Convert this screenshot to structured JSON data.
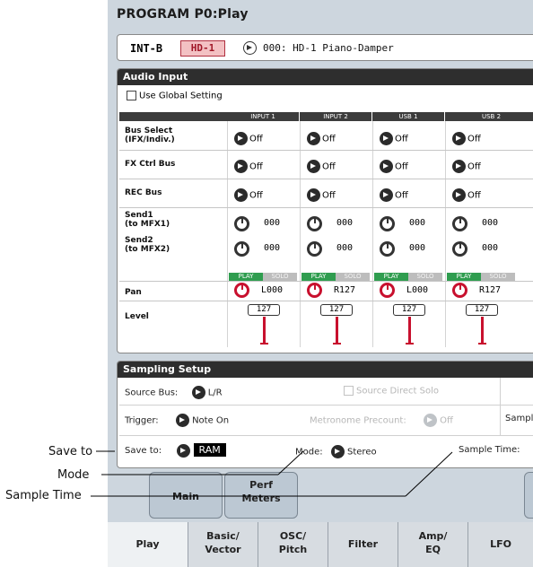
{
  "screen": {
    "title": "PROGRAM P0:Play"
  },
  "program": {
    "bank": "INT-B",
    "badge": "HD-1",
    "name": "000: HD-1 Piano-Damper"
  },
  "audio_input": {
    "section_label": "Audio Input",
    "use_global_setting": "Use Global Setting",
    "use_global_checked": false,
    "columns": [
      "INPUT 1",
      "INPUT 2",
      "USB 1",
      "USB 2"
    ],
    "rows": {
      "bus_select": "Bus Select\n(IFX/Indiv.)",
      "fx_ctrl_bus": "FX Ctrl Bus",
      "rec_bus": "REC Bus",
      "send1": "Send1\n(to MFX1)",
      "send2": "Send2\n(to MFX2)",
      "pan": "Pan",
      "level": "Level"
    },
    "values": {
      "bus_select": [
        "Off",
        "Off",
        "Off",
        "Off"
      ],
      "fx_ctrl_bus": [
        "Off",
        "Off",
        "Off",
        "Off"
      ],
      "rec_bus": [
        "Off",
        "Off",
        "Off",
        "Off"
      ],
      "send1": [
        "000",
        "000",
        "000",
        "000"
      ],
      "send2": [
        "000",
        "000",
        "000",
        "000"
      ],
      "pan": [
        "L000",
        "R127",
        "L000",
        "R127"
      ],
      "level": [
        "127",
        "127",
        "127",
        "127"
      ],
      "play": [
        "PLAY",
        "PLAY",
        "PLAY",
        "PLAY"
      ],
      "solo": [
        "SOLO",
        "SOLO",
        "SOLO",
        "SOLO"
      ]
    }
  },
  "sampling": {
    "section_label": "Sampling Setup",
    "source_bus_label": "Source Bus:",
    "source_bus_value": "L/R",
    "source_direct_solo": "Source Direct Solo",
    "trigger_label": "Trigger:",
    "trigger_value": "Note On",
    "metronome_precount_label": "Metronome Precount:",
    "metronome_precount_value": "Off",
    "sample_label_cut": "Sample",
    "save_to_label": "Save to:",
    "save_to_value": "RAM",
    "mode_label": "Mode:",
    "mode_value": "Stereo",
    "sample_time_label": "Sample Time:"
  },
  "upper_tabs": [
    "Main",
    "Perf\nMeters"
  ],
  "bottom_tabs": [
    "Play",
    "Basic/\nVector",
    "OSC/\nPitch",
    "Filter",
    "Amp/\nEQ",
    "LFO"
  ],
  "callouts": {
    "save_to": "Save to",
    "mode": "Mode",
    "sample_time": "Sample Time"
  },
  "colors": {
    "accent_red": "#c8102e",
    "play_green": "#2f9d4f",
    "panel_blue_grey": "#cdd6de"
  }
}
